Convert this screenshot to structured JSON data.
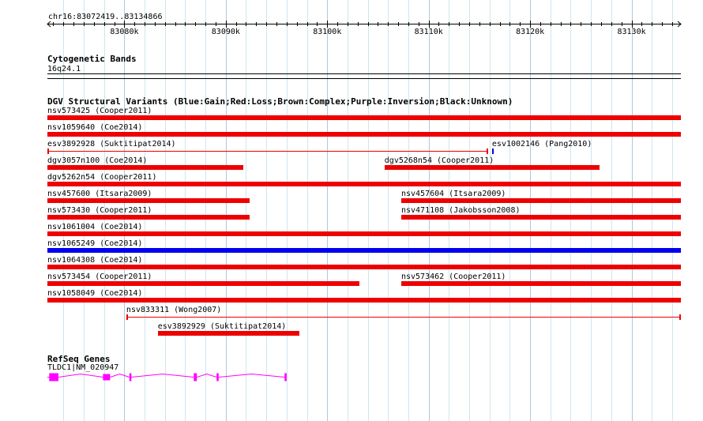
{
  "region": {
    "label": "chr16:83072419..83134866",
    "start": 83072419,
    "end": 83134866
  },
  "ruler": {
    "ticks": [
      {
        "pos": 83080000,
        "label": "83080k"
      },
      {
        "pos": 83090000,
        "label": "83090k"
      },
      {
        "pos": 83100000,
        "label": "83100k"
      },
      {
        "pos": 83110000,
        "label": "83110k"
      },
      {
        "pos": 83120000,
        "label": "83120k"
      },
      {
        "pos": 83130000,
        "label": "83130k"
      }
    ]
  },
  "cytobands": {
    "title": "Cytogenetic Bands",
    "band": "16q24.1"
  },
  "dgv": {
    "title": "DGV Structural Variants (Blue:Gain;Red:Loss;Brown:Complex;Purple:Inversion;Black:Unknown)",
    "colors": {
      "gain": "#0000ee",
      "loss": "#ee0000",
      "complex": "#8b4513",
      "inversion": "#800080",
      "unknown": "#000000"
    },
    "rows": [
      [
        {
          "label": "nsv573425 (Cooper2011)",
          "start": 72419,
          "end": 134866,
          "type": "loss",
          "style": "thick"
        }
      ],
      [
        {
          "label": "nsv1059640 (Coe2014)",
          "start": 72419,
          "end": 134866,
          "type": "loss",
          "style": "thick"
        }
      ],
      [
        {
          "label": "esv3892928 (Suktitipat2014)",
          "start": 72419,
          "end": 115900,
          "type": "loss",
          "style": "thin"
        },
        {
          "label": "esv1002146 (Pang2010)",
          "start": 116250,
          "end": 116450,
          "type": "gain",
          "style": "tick"
        }
      ],
      [
        {
          "label": "dgv3057n100 (Coe2014)",
          "start": 72419,
          "end": 91750,
          "type": "loss",
          "style": "thick"
        },
        {
          "label": "dgv5268n54 (Cooper2011)",
          "start": 105650,
          "end": 126800,
          "type": "loss",
          "style": "thick"
        }
      ],
      [
        {
          "label": "dgv5262n54 (Cooper2011)",
          "start": 72419,
          "end": 134866,
          "type": "loss",
          "style": "thick"
        }
      ],
      [
        {
          "label": "nsv457600 (Itsara2009)",
          "start": 72419,
          "end": 92350,
          "type": "loss",
          "style": "thick"
        },
        {
          "label": "nsv457604 (Itsara2009)",
          "start": 107300,
          "end": 134866,
          "type": "loss",
          "style": "thick"
        }
      ],
      [
        {
          "label": "nsv573430 (Cooper2011)",
          "start": 72419,
          "end": 92350,
          "type": "loss",
          "style": "thick"
        },
        {
          "label": "nsv471108 (Jakobsson2008)",
          "start": 107300,
          "end": 134866,
          "type": "loss",
          "style": "thick"
        }
      ],
      [
        {
          "label": "nsv1061004 (Coe2014)",
          "start": 72419,
          "end": 134866,
          "type": "loss",
          "style": "thick"
        }
      ],
      [
        {
          "label": "nsv1065249 (Coe2014)",
          "start": 72419,
          "end": 134866,
          "type": "gain",
          "style": "thick"
        }
      ],
      [
        {
          "label": "nsv1064308 (Coe2014)",
          "start": 72419,
          "end": 134866,
          "type": "loss",
          "style": "thick"
        }
      ],
      [
        {
          "label": "nsv573454 (Cooper2011)",
          "start": 72419,
          "end": 103200,
          "type": "loss",
          "style": "thick"
        },
        {
          "label": "nsv573462 (Cooper2011)",
          "start": 107300,
          "end": 134866,
          "type": "loss",
          "style": "thick"
        }
      ],
      [
        {
          "label": "nsv1058049 (Coe2014)",
          "start": 72419,
          "end": 134866,
          "type": "loss",
          "style": "thick"
        }
      ],
      [
        {
          "label": "nsv833311 (Wong2007)",
          "start": 80200,
          "end": 134866,
          "type": "loss",
          "style": "thin"
        }
      ],
      [
        {
          "label": "esv3892929 (Suktitipat2014)",
          "start": 83300,
          "end": 97200,
          "type": "loss",
          "style": "thick"
        }
      ]
    ]
  },
  "refseq": {
    "title": "RefSeq Genes",
    "color": "#ff00ff",
    "gene": {
      "label": "TLDC1|NM_020947",
      "start": 72419,
      "end": 96000,
      "strand": "-",
      "exons": [
        [
          72600,
          73500
        ],
        [
          77900,
          78600
        ],
        [
          80500,
          80700
        ],
        [
          86850,
          87150
        ],
        [
          89100,
          89300
        ],
        [
          95800,
          96000
        ]
      ]
    }
  }
}
